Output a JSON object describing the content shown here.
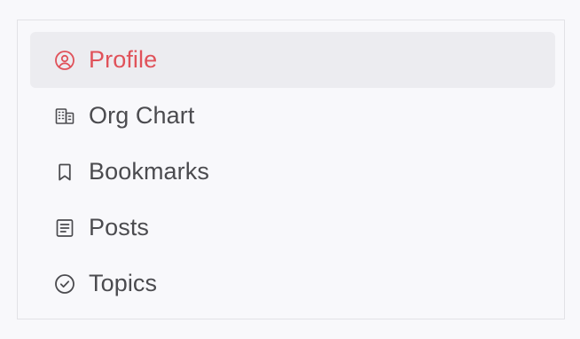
{
  "nav": {
    "accent_color": "#e0525a",
    "text_color": "#4b4b4f",
    "active_background": "#ececf0",
    "items": [
      {
        "label": "Profile",
        "icon": "user-circle-icon",
        "active": true
      },
      {
        "label": "Org Chart",
        "icon": "building-icon",
        "active": false
      },
      {
        "label": "Bookmarks",
        "icon": "bookmark-icon",
        "active": false
      },
      {
        "label": "Posts",
        "icon": "document-icon",
        "active": false
      },
      {
        "label": "Topics",
        "icon": "check-circle-icon",
        "active": false
      }
    ]
  }
}
